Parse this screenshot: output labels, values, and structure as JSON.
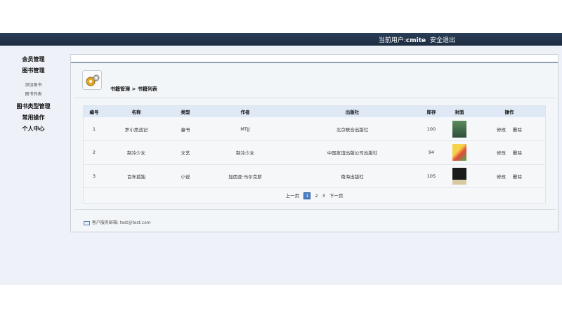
{
  "topbar": {
    "user_prefix": "当前用户:",
    "username": "cmite",
    "logout": "安全退出"
  },
  "sidebar": {
    "members": "会员管理",
    "books": "图书管理",
    "add_book": "添加图书",
    "book_list": "图书列表",
    "book_types": "图书类型管理",
    "common_ops": "常用操作",
    "personal": "个人中心"
  },
  "breadcrumb": {
    "parent": "书籍管理",
    "sep": ">",
    "current": "书籍列表"
  },
  "table": {
    "headers": [
      "编号",
      "名称",
      "类型",
      "作者",
      "出版社",
      "库存",
      "封面",
      "操作"
    ],
    "rows": [
      {
        "id": "1",
        "name": "罗小黑战记",
        "type": "童书",
        "author": "MTJJ",
        "publisher": "北京联合出版社",
        "stock": "100"
      },
      {
        "id": "2",
        "name": "制冷少女",
        "type": "文艺",
        "author": "制冷少女",
        "publisher": "中国友谊出版公司出版社",
        "stock": "94"
      },
      {
        "id": "3",
        "name": "百年孤独",
        "type": "小说",
        "author": "加西亚·马尔克斯",
        "publisher": "南海出版社",
        "stock": "105"
      }
    ],
    "edit_label": "修改",
    "delete_label": "删除"
  },
  "pager": {
    "prev": "上一页",
    "pages": [
      "1",
      "2",
      "3"
    ],
    "next": "下一页"
  },
  "footer": {
    "label": "客户服务邮箱:",
    "email": "test@test.com"
  }
}
